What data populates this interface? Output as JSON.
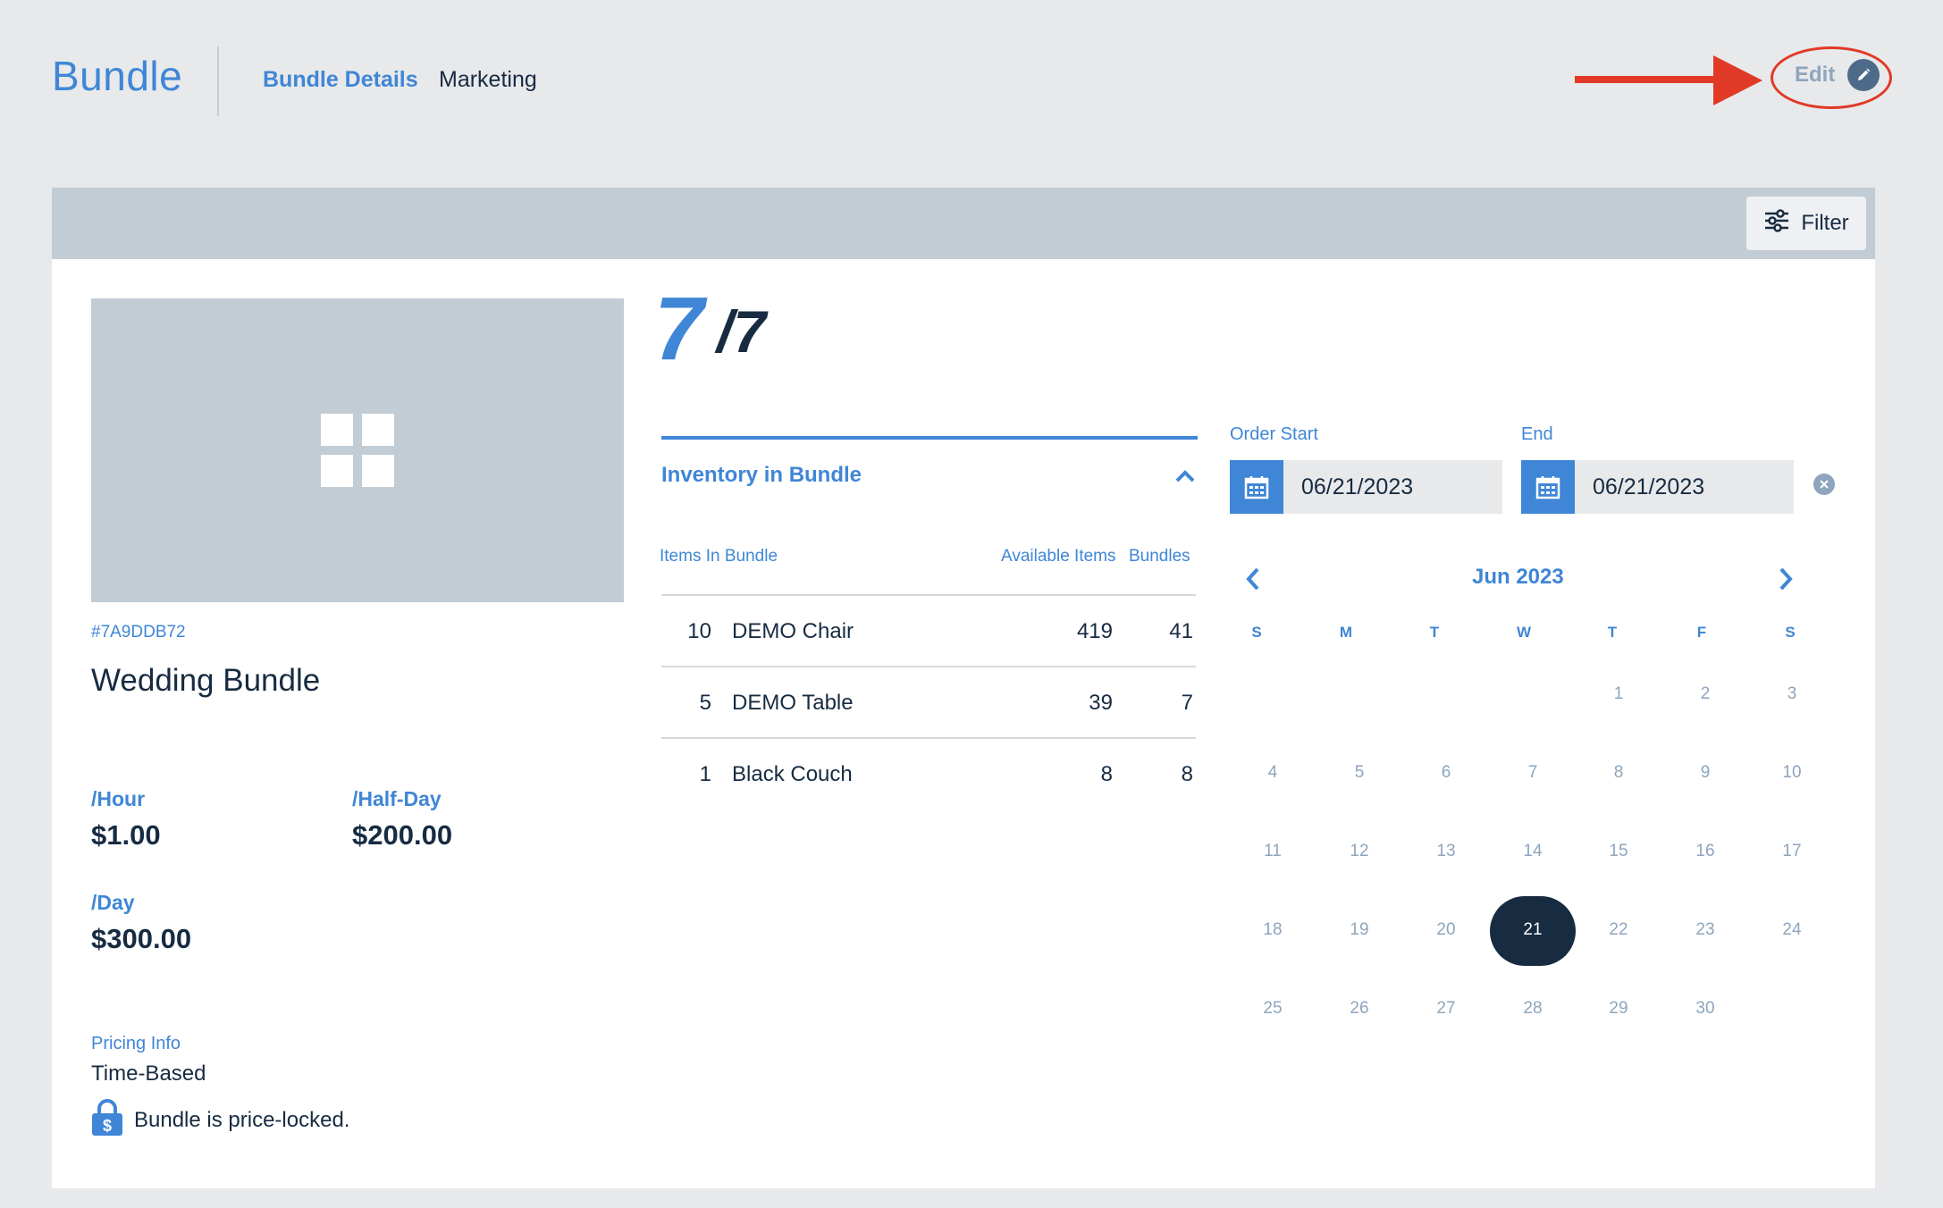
{
  "header": {
    "brand": "Bundle",
    "tabs": [
      {
        "label": "Bundle Details",
        "active": true
      },
      {
        "label": "Marketing",
        "active": false
      }
    ],
    "edit_label": "Edit"
  },
  "toolbar": {
    "filter_label": "Filter"
  },
  "bundle": {
    "id": "#7A9DDB72",
    "name": "Wedding Bundle",
    "pricing": [
      {
        "label": "/Hour",
        "value": "$1.00"
      },
      {
        "label": "/Half-Day",
        "value": "$200.00"
      },
      {
        "label": "/Day",
        "value": "$300.00"
      }
    ],
    "pricing_info_label": "Pricing Info",
    "pricing_info_value": "Time-Based",
    "lock_text": "Bundle is price-locked."
  },
  "availability": {
    "available": "7",
    "total": "/7"
  },
  "inventory": {
    "title": "Inventory in Bundle",
    "columns": {
      "items": "Items In Bundle",
      "available": "Available Items",
      "bundles": "Bundles"
    },
    "rows": [
      {
        "qty": "10",
        "name": "DEMO Chair",
        "available": "419",
        "bundles": "41"
      },
      {
        "qty": "5",
        "name": "DEMO Table",
        "available": "39",
        "bundles": "7"
      },
      {
        "qty": "1",
        "name": "Black Couch",
        "available": "8",
        "bundles": "8"
      }
    ]
  },
  "order": {
    "start_label": "Order Start",
    "start_value": "06/21/2023",
    "end_label": "End",
    "end_value": "06/21/2023"
  },
  "calendar": {
    "month_label": "Jun 2023",
    "weekdays": [
      "S",
      "M",
      "T",
      "W",
      "T",
      "F",
      "S"
    ],
    "days": [
      "1",
      "2",
      "3",
      "4",
      "5",
      "6",
      "7",
      "8",
      "9",
      "10",
      "11",
      "12",
      "13",
      "14",
      "15",
      "16",
      "17",
      "18",
      "19",
      "20",
      "21",
      "22",
      "23",
      "24",
      "25",
      "26",
      "27",
      "28",
      "29",
      "30"
    ],
    "selected_day": "21"
  },
  "colors": {
    "accent": "#3f86d6",
    "dark": "#172b41",
    "muted": "#8ea5bd",
    "annotation": "#e03a26"
  }
}
